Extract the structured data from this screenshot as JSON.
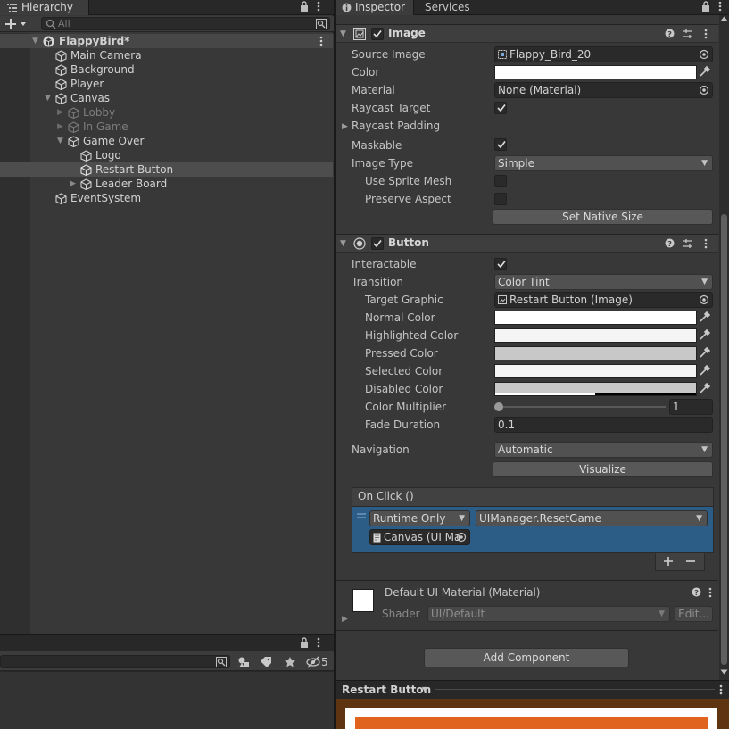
{
  "hierarchy": {
    "tab_label": "Hierarchy",
    "search_placeholder": "All",
    "scene": "FlappyBird*",
    "items": [
      {
        "label": "Main Camera"
      },
      {
        "label": "Background"
      },
      {
        "label": "Player"
      },
      {
        "label": "Canvas"
      },
      {
        "label": "Lobby"
      },
      {
        "label": "In Game"
      },
      {
        "label": "Game Over"
      },
      {
        "label": "Logo"
      },
      {
        "label": "Restart Button"
      },
      {
        "label": "Leader Board"
      },
      {
        "label": "EventSystem"
      }
    ]
  },
  "project": {
    "hidden_count": "5"
  },
  "inspector": {
    "tab_label": "Inspector",
    "tab2_label": "Services",
    "image": {
      "title": "Image",
      "source_image_label": "Source Image",
      "source_image_value": "Flappy_Bird_20",
      "color_label": "Color",
      "material_label": "Material",
      "material_value": "None (Material)",
      "raycast_target_label": "Raycast Target",
      "raycast_padding_label": "Raycast Padding",
      "maskable_label": "Maskable",
      "image_type_label": "Image Type",
      "image_type_value": "Simple",
      "use_sprite_mesh_label": "Use Sprite Mesh",
      "preserve_aspect_label": "Preserve Aspect",
      "set_native_size_label": "Set Native Size"
    },
    "button": {
      "title": "Button",
      "interactable_label": "Interactable",
      "transition_label": "Transition",
      "transition_value": "Color Tint",
      "target_graphic_label": "Target Graphic",
      "target_graphic_value": "Restart Button (Image)",
      "normal_color_label": "Normal Color",
      "highlighted_color_label": "Highlighted Color",
      "pressed_color_label": "Pressed Color",
      "selected_color_label": "Selected Color",
      "disabled_color_label": "Disabled Color",
      "color_multiplier_label": "Color Multiplier",
      "color_multiplier_value": "1",
      "fade_duration_label": "Fade Duration",
      "fade_duration_value": "0.1",
      "navigation_label": "Navigation",
      "navigation_value": "Automatic",
      "visualize_label": "Visualize",
      "on_click_label": "On Click ()",
      "runtime_value": "Runtime Only",
      "function_value": "UIManager.ResetGame",
      "object_value": "Canvas (UI Ma"
    },
    "material": {
      "title": "Default UI Material (Material)",
      "shader_label": "Shader",
      "shader_value": "UI/Default",
      "edit_label": "Edit..."
    },
    "add_component_label": "Add Component",
    "preview_title": "Restart Button"
  },
  "colors": {
    "panel_bg": "#383838",
    "selection_blue": "#2c5d87",
    "preview_orange": "#e0641e"
  }
}
